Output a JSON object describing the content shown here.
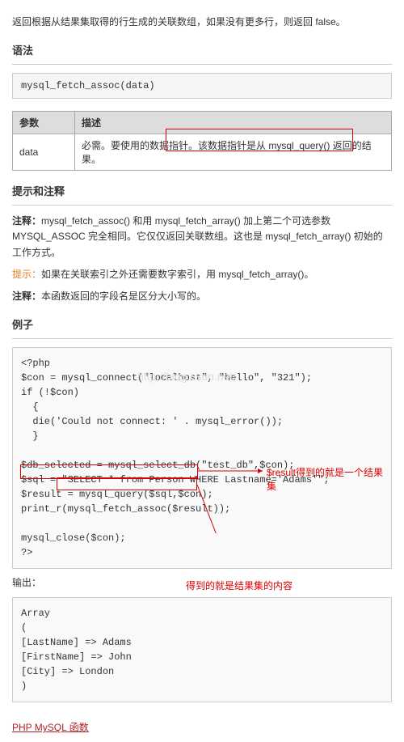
{
  "intro": "返回根据从结果集取得的行生成的关联数组，如果没有更多行，则返回 false。",
  "syntax": {
    "heading": "语法",
    "code": "mysql_fetch_assoc(data)"
  },
  "params": {
    "headers": [
      "参数",
      "描述"
    ],
    "rows": [
      {
        "name": "data",
        "desc_a": "必需。要使用的数据指针。",
        "desc_b": "该数据指针是从 mysql_query() 返回的结果。"
      }
    ]
  },
  "notes": {
    "heading": "提示和注释",
    "note1_label": "注释：",
    "note1_text": "mysql_fetch_assoc() 和用 mysql_fetch_array() 加上第二个可选参数 MYSQL_ASSOC 完全相同。它仅仅返回关联数组。这也是 mysql_fetch_array() 初始的工作方式。",
    "tip_label": "提示：",
    "tip_text": "如果在关联索引之外还需要数字索引，用 mysql_fetch_array()。",
    "note2_label": "注释：",
    "note2_text": "本函数返回的字段名是区分大小写的。"
  },
  "example": {
    "heading": "例子",
    "watermark": "http://blog.csdn.net/",
    "code_lines": [
      "<?php",
      "$con = mysql_connect(\"localhost\", \"hello\", \"321\");",
      "if (!$con)",
      "  {",
      "  die('Could not connect: ' . mysql_error());",
      "  }",
      "",
      "$db_selected = mysql_select_db(\"test_db\",$con);",
      "$sql = \"SELECT * from Person WHERE Lastname='Adams'\";",
      "$result = mysql_query($sql,$con);",
      "print_r(mysql_fetch_assoc($result));",
      "",
      "mysql_close($con);",
      "?>"
    ],
    "annot1": "$result得到的就是一个结果集",
    "output_label": "输出：",
    "annot2": "得到的就是结果集的内容",
    "output_lines": [
      "Array",
      "(",
      "[LastName] => Adams",
      "[FirstName] => John",
      "[City] => London",
      ")"
    ]
  },
  "footer_link": "PHP MySQL 函数"
}
